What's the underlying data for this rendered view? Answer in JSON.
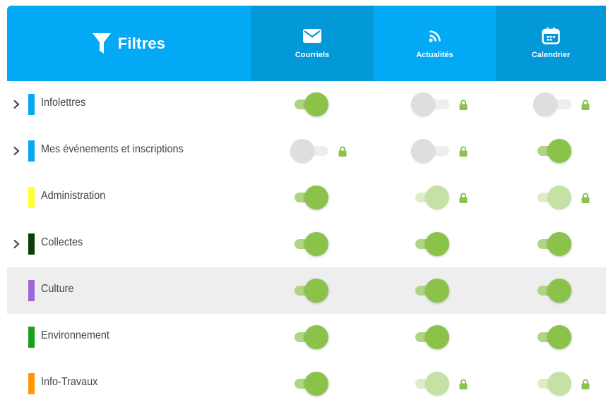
{
  "header": {
    "title": "Filtres",
    "columns": [
      {
        "label": "Courriels",
        "icon": "envelope-icon"
      },
      {
        "label": "Actualités",
        "icon": "rss-icon"
      },
      {
        "label": "Calendrier",
        "icon": "calendar-icon"
      }
    ]
  },
  "colors": {
    "header": "#03a9f4",
    "header_alt": "#0398d8",
    "toggle_on": "#8bc34a",
    "toggle_on_disabled": "#c5e1a5",
    "toggle_off": "#dedede",
    "lock": "#8bc34a"
  },
  "rows": [
    {
      "label": "Infolettres",
      "color": "#03a9f4",
      "expandable": true,
      "highlighted": false,
      "toggles": [
        {
          "on": true,
          "locked": false
        },
        {
          "on": false,
          "locked": true
        },
        {
          "on": false,
          "locked": true
        }
      ]
    },
    {
      "label": "Mes événements et inscriptions",
      "color": "#03a9f4",
      "expandable": true,
      "highlighted": false,
      "toggles": [
        {
          "on": false,
          "locked": true
        },
        {
          "on": false,
          "locked": true
        },
        {
          "on": true,
          "locked": false
        }
      ]
    },
    {
      "label": "Administration",
      "color": "#ffff33",
      "expandable": false,
      "highlighted": false,
      "toggles": [
        {
          "on": true,
          "locked": false
        },
        {
          "on": true,
          "locked": true
        },
        {
          "on": true,
          "locked": true
        }
      ]
    },
    {
      "label": "Collectes",
      "color": "#0b3d0b",
      "expandable": true,
      "highlighted": false,
      "toggles": [
        {
          "on": true,
          "locked": false
        },
        {
          "on": true,
          "locked": false
        },
        {
          "on": true,
          "locked": false
        }
      ]
    },
    {
      "label": "Culture",
      "color": "#9c66d6",
      "expandable": false,
      "highlighted": true,
      "toggles": [
        {
          "on": true,
          "locked": false
        },
        {
          "on": true,
          "locked": false
        },
        {
          "on": true,
          "locked": false
        }
      ]
    },
    {
      "label": "Environnement",
      "color": "#1e9e1e",
      "expandable": false,
      "highlighted": false,
      "toggles": [
        {
          "on": true,
          "locked": false
        },
        {
          "on": true,
          "locked": false
        },
        {
          "on": true,
          "locked": false
        }
      ]
    },
    {
      "label": "Info-Travaux",
      "color": "#ff9800",
      "expandable": false,
      "highlighted": false,
      "toggles": [
        {
          "on": true,
          "locked": false
        },
        {
          "on": true,
          "locked": true
        },
        {
          "on": true,
          "locked": true
        }
      ]
    }
  ]
}
